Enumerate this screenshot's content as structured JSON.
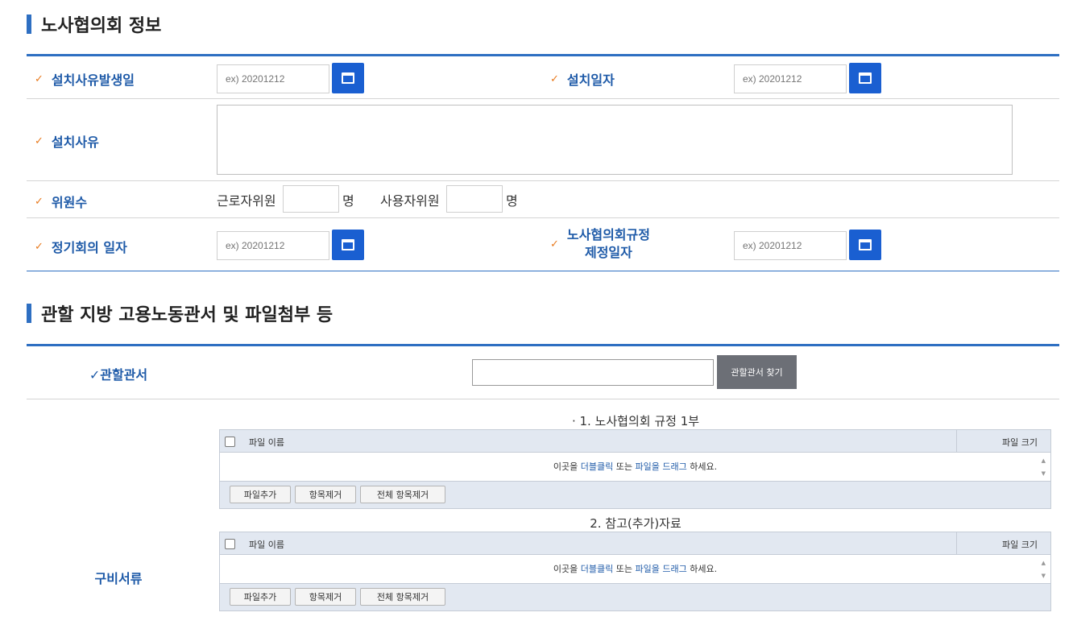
{
  "section1": {
    "title": "노사협의회 정보",
    "check_mark": "✓",
    "fields": {
      "occurrence_date": {
        "label": "설치사유발생일",
        "placeholder": "ex) 20201212"
      },
      "install_date": {
        "label": "설치일자",
        "placeholder": "ex) 20201212"
      },
      "install_reason": {
        "label": "설치사유",
        "value": ""
      },
      "members": {
        "label": "위원수",
        "worker_label": "근로자위원",
        "employer_label": "사용자위원",
        "unit": "명"
      },
      "regular_meeting": {
        "label": "정기회의 일자",
        "placeholder": "ex) 20201212"
      },
      "regulation_date": {
        "label_line1": "노사협의회규정",
        "label_line2": "제정일자",
        "placeholder": "ex) 20201212"
      }
    }
  },
  "section2": {
    "title": "관할 지방 고용노동관서 및 파일첨부 등",
    "office": {
      "label": "✓관할관서",
      "button": "관할관서 찾기",
      "value": ""
    },
    "docs_label": "구비서류",
    "uploaders": [
      {
        "title": "· 1. 노사협의회 규정 1부",
        "col_name": "파일 이름",
        "col_size": "파일 크기",
        "drop_text_1": "이곳을 ",
        "drop_link_1": "더블클릭",
        "drop_text_2": " 또는 ",
        "drop_link_2": "파일을 드래그",
        "drop_text_3": " 하세요.",
        "btn_add": "파일추가",
        "btn_remove": "항목제거",
        "btn_remove_all": "전체 항목제거"
      },
      {
        "title": "2. 참고(추가)자료",
        "col_name": "파일 이름",
        "col_size": "파일 크기",
        "drop_text_1": "이곳을 ",
        "drop_link_1": "더블클릭",
        "drop_text_2": " 또는 ",
        "drop_link_2": "파일을 드래그",
        "drop_text_3": " 하세요.",
        "btn_add": "파일추가",
        "btn_remove": "항목제거",
        "btn_remove_all": "전체 항목제거"
      }
    ]
  },
  "colors": {
    "accent": "#2e6fc2",
    "check": "#e87a1e",
    "calendar_button": "#1a5fd1",
    "search_button": "#6c6f76"
  }
}
